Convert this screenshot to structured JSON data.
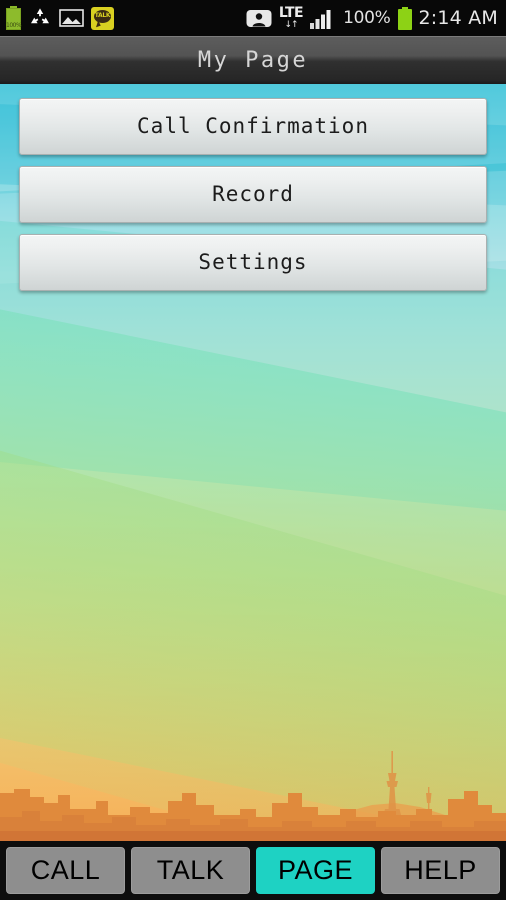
{
  "status_bar": {
    "notification_icons": [
      {
        "name": "battery-saver-icon",
        "label": "100%"
      },
      {
        "name": "recycle-icon",
        "label": ""
      },
      {
        "name": "gallery-image-icon",
        "label": ""
      },
      {
        "name": "kakaotalk-icon",
        "label": "TALK"
      }
    ],
    "contacts_icon": "contact-icon",
    "network_type": "LTE",
    "network_arrows": "↓↑",
    "signal_icon": "signal-bars-icon",
    "battery_percent": "100%",
    "battery_icon": "battery-full-icon",
    "time": "2:14 AM"
  },
  "title_bar": {
    "title": "My Page"
  },
  "menu": {
    "buttons": [
      {
        "label": "Call Confirmation",
        "name": "call-confirmation-button"
      },
      {
        "label": "Record",
        "name": "record-button"
      },
      {
        "label": "Settings",
        "name": "settings-button"
      }
    ]
  },
  "tabbar": {
    "tabs": [
      {
        "label": "CALL",
        "active": false
      },
      {
        "label": "TALK",
        "active": false
      },
      {
        "label": "PAGE",
        "active": true
      },
      {
        "label": "HELP",
        "active": false
      }
    ],
    "active_color": "#1ed2c3",
    "inactive_color": "#8e8e8e"
  },
  "wallpaper": {
    "description": "city-skyline-wallpaper",
    "sky_top_color": "#25bcd4",
    "sky_bottom_color": "#f3ad58",
    "skyline_color": "#e08a3c"
  }
}
